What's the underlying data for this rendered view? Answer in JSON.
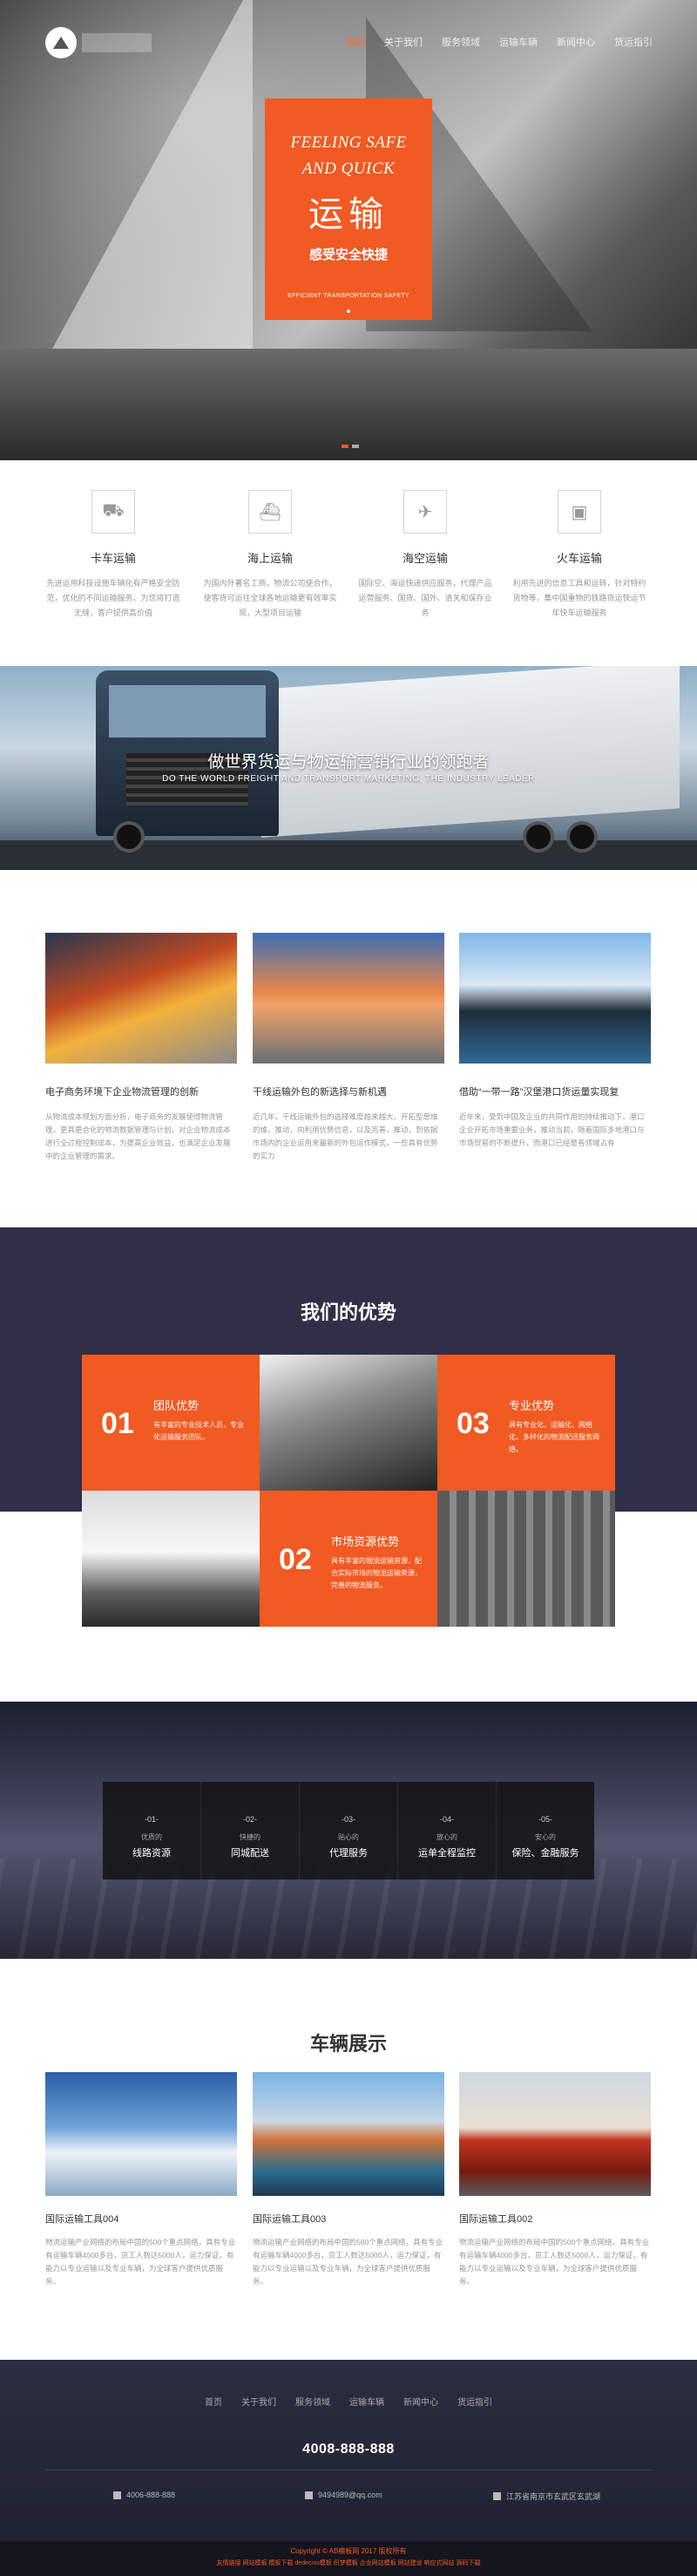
{
  "nav": {
    "items": [
      "首页",
      "关于我们",
      "服务领域",
      "运输车辆",
      "新闻中心",
      "货运指引"
    ],
    "active_index": 0
  },
  "hero": {
    "line1": "FEELING SAFE",
    "line2": "AND QUICK",
    "title_cn": "运输",
    "subtitle_cn": "感受安全快捷",
    "tagline": "EFFICIENT TRANSPORTATION SAFETY",
    "slides": 2,
    "active_slide": 1
  },
  "services": [
    {
      "icon": "truck-icon",
      "title": "卡车运输",
      "desc": "先进运用科技设施车辆化有严格安全防范，优化的不同运输服务。为您将打造无缝，客户提供高价值"
    },
    {
      "icon": "ship-icon",
      "title": "海上运输",
      "desc": "为国内外著名工商，物流公司使合作，使客货可运往全球各地运输更有效率实现，大型项目运输"
    },
    {
      "icon": "plane-icon",
      "title": "海空运输",
      "desc": "国际空、海运快递供应服务，代理产品运营服务、国货、国外、清关和保存业务"
    },
    {
      "icon": "train-icon",
      "title": "火车运输",
      "desc": "利用先进的信息工具和运转，针对特约货物等，集中国重物的铁路货运快运节年快车运输服务"
    }
  ],
  "truck_banner": {
    "title": "做世界货运与物运输营销行业的领跑者",
    "subtitle": "DO THE WORLD FREIGHT AND TRANSPORT MARKETING, THE INDUSTRY LEADER"
  },
  "news": [
    {
      "title": "电子商务环境下企业物流管理的创新",
      "desc": "从物流成本规划方面分析，电子商务的发展使得物流管理，更具更合化的物流数据管理与计划，对企业物流成本进行全过程控制成本，为提高企业效益，也满足企业发展中的企业管理的需求。"
    },
    {
      "title": "干线运输外包的新选择与新机遇",
      "desc": "近几年，干线运输外包的选择难度越来越大，开拓型思维的维，推动，向利用优势信息，以及完善，推动，到依据市场内的企业运用来最新的外包运作模式，一些具有优势的实力"
    },
    {
      "title": "借助“一带一路”汉堡港口货运量实现复",
      "desc": "近年来，受到中国及企业的共同作用的持续推动下，港口企业开拓市场重要业务，推动当前，随着国际多地港口与市场贸易的不断提升，而港口已经是各领域占有"
    }
  ],
  "advantages": {
    "title": "我们的优势",
    "items": [
      {
        "num": "01",
        "title": "团队优势",
        "desc": "有丰富的专业技术人员，专业化运输服务团队。"
      },
      {
        "num": "03",
        "title": "专业优势",
        "desc": "具有专业化、运输化、网络化、多样化的物流配送服务网络。"
      },
      {
        "num": "02",
        "title": "市场资源优势",
        "desc": "具有丰富的物流运输资源，配合实际市场的物流运输资源，完善的物流服务。"
      }
    ]
  },
  "flow": [
    {
      "num": "-01-",
      "top": "优质的",
      "bottom": "线路资源"
    },
    {
      "num": "-02-",
      "top": "快捷的",
      "bottom": "同城配送"
    },
    {
      "num": "-03-",
      "top": "贴心的",
      "bottom": "代理服务"
    },
    {
      "num": "-04-",
      "top": "放心的",
      "bottom": "运单全程监控"
    },
    {
      "num": "-05-",
      "top": "安心的",
      "bottom": "保险、金融服务"
    }
  ],
  "vehicles": {
    "title": "车辆展示",
    "items": [
      {
        "title": "国际运输工具004",
        "desc": "物流运输产业网络的布局中国的500个重点网络，具有专业有运输车辆4000多台，员工人数达5000人，运力保证，有能力以专业运输以及专业车辆，为全球客户提供优质服务。"
      },
      {
        "title": "国际运输工具003",
        "desc": "物流运输产业网络的布局中国的500个重点网络，具有专业有运输车辆4000多台，员工人数达5000人，运力保证，有能力以专业运输以及专业车辆，为全球客户提供优质服务。"
      },
      {
        "title": "国际运输工具002",
        "desc": "物流运输产业网络的布局中国的500个重点网络，具有专业有运输车辆4000多台，员工人数达5000人，运力保证，有能力以专业运输以及专业车辆，为全球客户提供优质服务。"
      }
    ]
  },
  "footer": {
    "nav": [
      "首页",
      "关于我们",
      "服务领域",
      "运输车辆",
      "新闻中心",
      "货运指引"
    ],
    "hotline": "4008-888-888",
    "phone": "4006-888-888",
    "email": "9494989@qq.com",
    "address": "江苏省南京市玄武区玄武湖",
    "copyright": "Copyright © AB模板网 2017 版权所有",
    "links": "友情链接  网站模板  模板下载  dedecms模板  织梦模板  企业网站模板  网站建设  响应式网站  源码下载"
  },
  "colors": {
    "accent": "#f15a22",
    "dark": "#2f3047"
  }
}
